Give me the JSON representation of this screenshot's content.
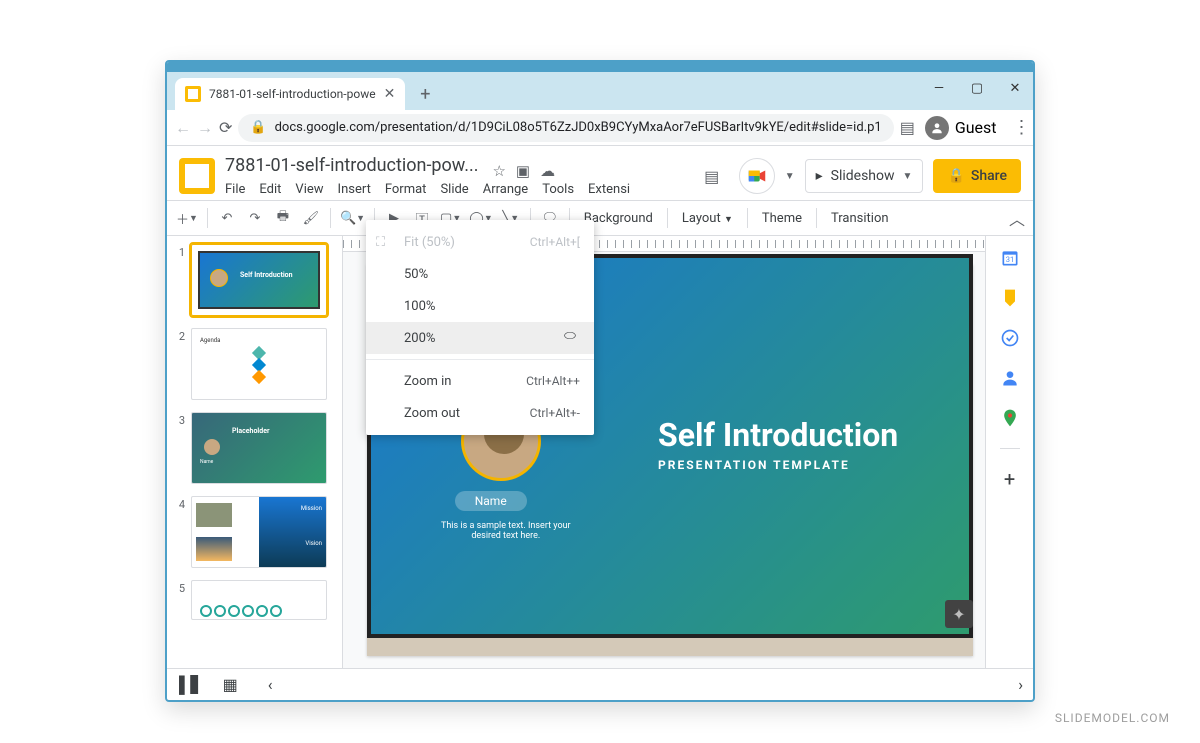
{
  "browser": {
    "tab_title": "7881-01-self-introduction-powe",
    "url": "docs.google.com/presentation/d/1D9CiL08o5T6ZzJD0xB9CYyMxaAor7eFUSBarItv9kYE/edit#slide=id.p1",
    "guest_label": "Guest"
  },
  "doc": {
    "title": "7881-01-self-introduction-pow...",
    "menus": [
      "File",
      "Edit",
      "View",
      "Insert",
      "Format",
      "Slide",
      "Arrange",
      "Tools",
      "Extensi"
    ]
  },
  "header": {
    "slideshow_label": "Slideshow",
    "share_label": "Share"
  },
  "toolbar": {
    "background": "Background",
    "layout": "Layout",
    "theme": "Theme",
    "transition": "Transition"
  },
  "zoom_menu": {
    "fit": "Fit (50%)",
    "fit_shortcut": "Ctrl+Alt+[",
    "p50": "50%",
    "p100": "100%",
    "p200": "200%",
    "zoom_in": "Zoom in",
    "zoom_in_shortcut": "Ctrl+Alt++",
    "zoom_out": "Zoom out",
    "zoom_out_shortcut": "Ctrl+Alt+-"
  },
  "slide": {
    "title": "Self Introduction",
    "subtitle": "PRESENTATION TEMPLATE",
    "name_label": "Name",
    "sample": "This is a sample text. Insert your desired text here."
  },
  "thumbs": {
    "agenda": "Agenda",
    "placeholder": "Placeholder",
    "name": "Name",
    "mission": "Mission",
    "vision": "Vision",
    "selfintro": "Self Introduction"
  },
  "watermark": "SLIDEMODEL.COM"
}
